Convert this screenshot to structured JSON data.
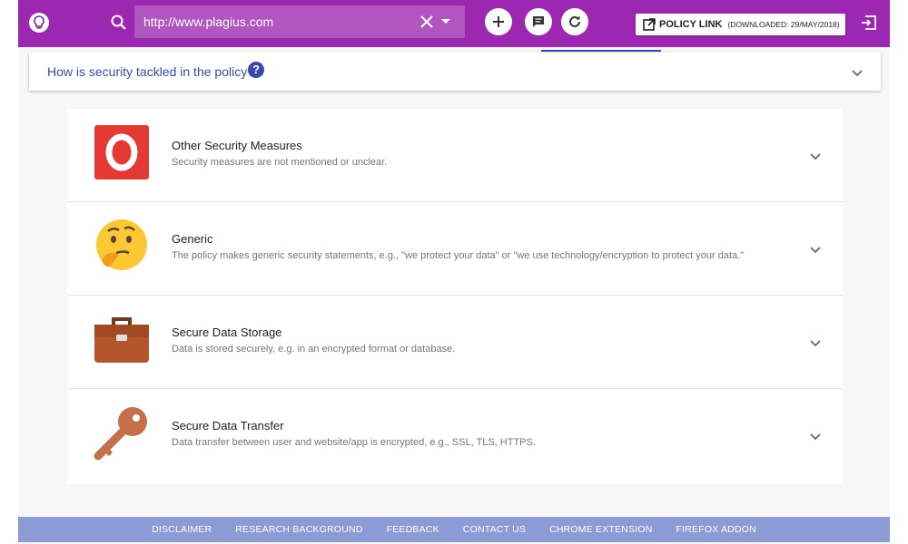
{
  "header": {
    "url_value": "http://www.plagius.com",
    "policy_label": "POLICY LINK",
    "downloaded_label": "(DOWNLOADED: 29/MAY/2018)"
  },
  "question": {
    "text": "How is security tackled in the policy?",
    "help_glyph": "?"
  },
  "items": [
    {
      "title": "Other Security Measures",
      "desc": "Security measures are not mentioned or unclear.",
      "icon": "red-o-icon"
    },
    {
      "title": "Generic",
      "desc": "The policy makes generic security statements, e.g., \"we protect your data\" or \"we use technology/encryption to protect your data.\"",
      "icon": "thinking-face-icon"
    },
    {
      "title": "Secure Data Storage",
      "desc": "Data is stored securely, e.g. in an encrypted format or database.",
      "icon": "briefcase-icon"
    },
    {
      "title": "Secure Data Transfer",
      "desc": "Data transfer between user and website/app is encrypted, e.g., SSL, TLS, HTTPS.",
      "icon": "key-icon"
    }
  ],
  "footer": {
    "links": [
      "DISCLAIMER",
      "RESEARCH BACKGROUND",
      "FEEDBACK",
      "CONTACT US",
      "CHROME EXTENSION",
      "FIREFOX ADDON"
    ]
  },
  "colors": {
    "topbar": "#9c27b0",
    "footer": "#8c9bd6",
    "accent": "#3949ab"
  }
}
